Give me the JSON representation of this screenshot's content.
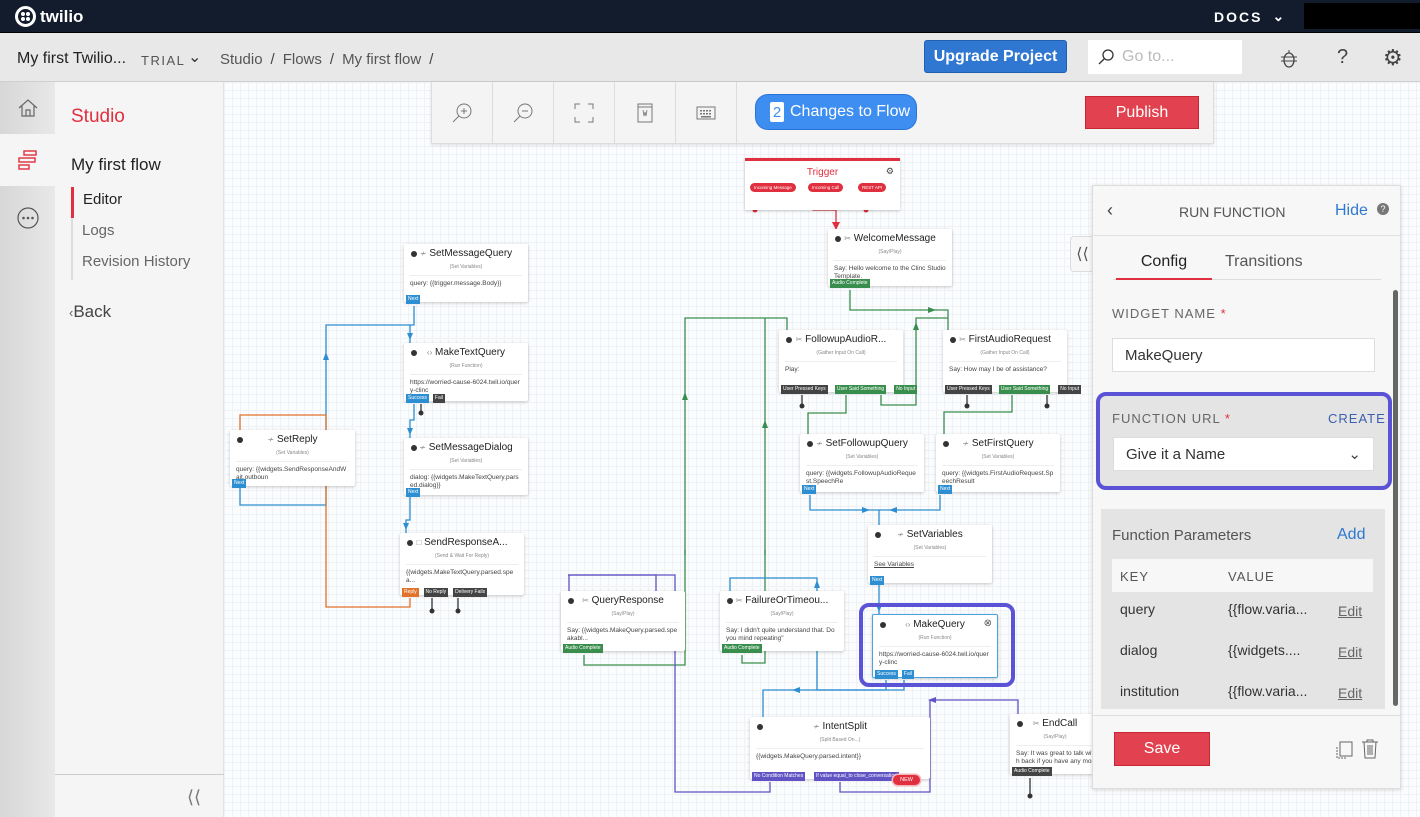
{
  "topbar": {
    "brand": "twilio",
    "docs_label": "DOCS"
  },
  "navbar": {
    "project_name": "My first Twilio...",
    "project_tier": "TRIAL",
    "breadcrumbs": [
      "Studio",
      "Flows",
      "My first flow"
    ],
    "breadcrumb_sep": "/",
    "upgrade_label": "Upgrade Project",
    "goto_placeholder": "Go to..."
  },
  "sidebar": {
    "section_title": "Studio",
    "flow_name": "My first flow",
    "links": [
      {
        "label": "Editor",
        "active": true
      },
      {
        "label": "Logs",
        "active": false
      },
      {
        "label": "Revision History",
        "active": false
      }
    ],
    "back_label": "Back"
  },
  "toolbar": {
    "changes_count": "2",
    "changes_label": "Changes to Flow",
    "publish_label": "Publish"
  },
  "flow": {
    "trigger": {
      "name": "Trigger",
      "pills": [
        "Incoming Message",
        "Incoming Call",
        "REST API"
      ]
    },
    "widgets": [
      {
        "id": "welcome",
        "name": "WelcomeMessage",
        "type": "(Say/Play)",
        "body": "Say: Hello welcome to the Clinc Studio Template.",
        "transitions": [
          {
            "label": "Audio Complete",
            "color": "green"
          }
        ]
      },
      {
        "id": "setmsgquery",
        "name": "SetMessageQuery",
        "type": "(Set Variables)",
        "body": "query: {{trigger.message.Body}}",
        "transitions": [
          {
            "label": "Next",
            "color": "blue"
          }
        ]
      },
      {
        "id": "maketextquery",
        "name": "MakeTextQuery",
        "type": "(Run Function)",
        "body": "https://worried-cause-6024.twil.io/query-clinc",
        "transitions": [
          {
            "label": "Success",
            "color": "blue"
          },
          {
            "label": "Fail",
            "color": "dark"
          }
        ]
      },
      {
        "id": "setreply",
        "name": "SetReply",
        "type": "(Set Variables)",
        "body": "query: {{widgets.SendResponseAndWait.outboun",
        "transitions": [
          {
            "label": "Next",
            "color": "blue"
          }
        ]
      },
      {
        "id": "setmsgdialog",
        "name": "SetMessageDialog",
        "type": "(Set Variables)",
        "body": "dialog: {{widgets.MakeTextQuery.parsed.dialog}}",
        "transitions": [
          {
            "label": "Next",
            "color": "blue"
          }
        ]
      },
      {
        "id": "sendresponse",
        "name": "SendResponseA...",
        "type": "(Send & Wait For Reply)",
        "body": "{{widgets.MakeTextQuery.parsed.spea...",
        "transitions": [
          {
            "label": "Reply",
            "color": "orange"
          },
          {
            "label": "No Reply",
            "color": "dark"
          },
          {
            "label": "Delivery Fails",
            "color": "dark"
          }
        ]
      },
      {
        "id": "followup",
        "name": "FollowupAudioR...",
        "type": "(Gather Input On Call)",
        "body": "Play:",
        "transitions": [
          {
            "label": "User Pressed Keys",
            "color": "dark"
          },
          {
            "label": "User Said Something",
            "color": "green"
          },
          {
            "label": "No Input",
            "color": "green"
          }
        ]
      },
      {
        "id": "firstaudio",
        "name": "FirstAudioRequest",
        "type": "(Gather Input On Call)",
        "body": "Say: How may I be of assistance?",
        "transitions": [
          {
            "label": "User Pressed Keys",
            "color": "dark"
          },
          {
            "label": "User Said Something",
            "color": "green"
          },
          {
            "label": "No Input",
            "color": "dark"
          }
        ]
      },
      {
        "id": "setfollowup",
        "name": "SetFollowupQuery",
        "type": "(Set Variables)",
        "body": "query: {{widgets.FollowupAudioRequest.SpeechRe",
        "transitions": [
          {
            "label": "Next",
            "color": "blue"
          }
        ]
      },
      {
        "id": "setfirst",
        "name": "SetFirstQuery",
        "type": "(Set Variables)",
        "body": "query: {{widgets.FirstAudioRequest.SpeechResult",
        "transitions": [
          {
            "label": "Next",
            "color": "blue"
          }
        ]
      },
      {
        "id": "setvars",
        "name": "SetVariables",
        "type": "(Set Variables)",
        "body": "See Variables",
        "transitions": [
          {
            "label": "Next",
            "color": "blue"
          }
        ]
      },
      {
        "id": "queryresponse",
        "name": "QueryResponse",
        "type": "(Say/Play)",
        "body": "Say: {{widgets.MakeQuery.parsed.speakabl...",
        "transitions": [
          {
            "label": "Audio Complete",
            "color": "green"
          }
        ]
      },
      {
        "id": "failure",
        "name": "FailureOrTimeou...",
        "type": "(Say/Play)",
        "body": "Say: I didn't quite understand that. Do you mind repeating\"",
        "transitions": [
          {
            "label": "Audio Complete",
            "color": "green"
          }
        ]
      },
      {
        "id": "makequery",
        "name": "MakeQuery",
        "type": "(Run Function)",
        "body": "https://worried-cause-6024.twil.io/query-clinc",
        "transitions": [
          {
            "label": "Success",
            "color": "blue"
          },
          {
            "label": "Fail",
            "color": "blue"
          }
        ]
      },
      {
        "id": "intentsplit",
        "name": "IntentSplit",
        "type": "(Split Based On...)",
        "body": "{{widgets.MakeQuery.parsed.intent}}",
        "transitions": [
          {
            "label": "No Condition Matches",
            "color": "purple"
          },
          {
            "label": "If value equal_to close_conversation",
            "color": "purple"
          }
        ],
        "new_label": "NEW"
      },
      {
        "id": "endcall",
        "name": "EndCall",
        "type": "(Say/Play)",
        "body": "Say: It was great to talk with back if you have any more qu",
        "transitions": [
          {
            "label": "Audio Complete",
            "color": "dark"
          }
        ]
      }
    ]
  },
  "panel": {
    "title": "RUN FUNCTION",
    "hide_label": "Hide",
    "tabs": [
      {
        "label": "Config",
        "active": true
      },
      {
        "label": "Transitions",
        "active": false
      }
    ],
    "widget_name_label": "WIDGET NAME",
    "widget_name_value": "MakeQuery",
    "function_url_label": "FUNCTION URL",
    "create_label": "CREATE",
    "function_url_value": "Give it a Name",
    "params_title": "Function Parameters",
    "add_label": "Add",
    "params_headers": [
      "KEY",
      "VALUE"
    ],
    "params": [
      {
        "key": "query",
        "value": "{{flow.varia...",
        "action": "Edit"
      },
      {
        "key": "dialog",
        "value": "{{widgets....",
        "action": "Edit"
      },
      {
        "key": "institution",
        "value": "{{flow.varia...",
        "action": "Edit"
      }
    ],
    "save_label": "Save"
  },
  "colors": {
    "brand_red": "#e02f3e",
    "link_blue": "#2f77d1",
    "highlight": "#5a53d6",
    "wire_green": "#3a8e4d",
    "wire_blue": "#2d8ed1",
    "wire_orange": "#e0722a",
    "wire_purple": "#6053c4"
  }
}
